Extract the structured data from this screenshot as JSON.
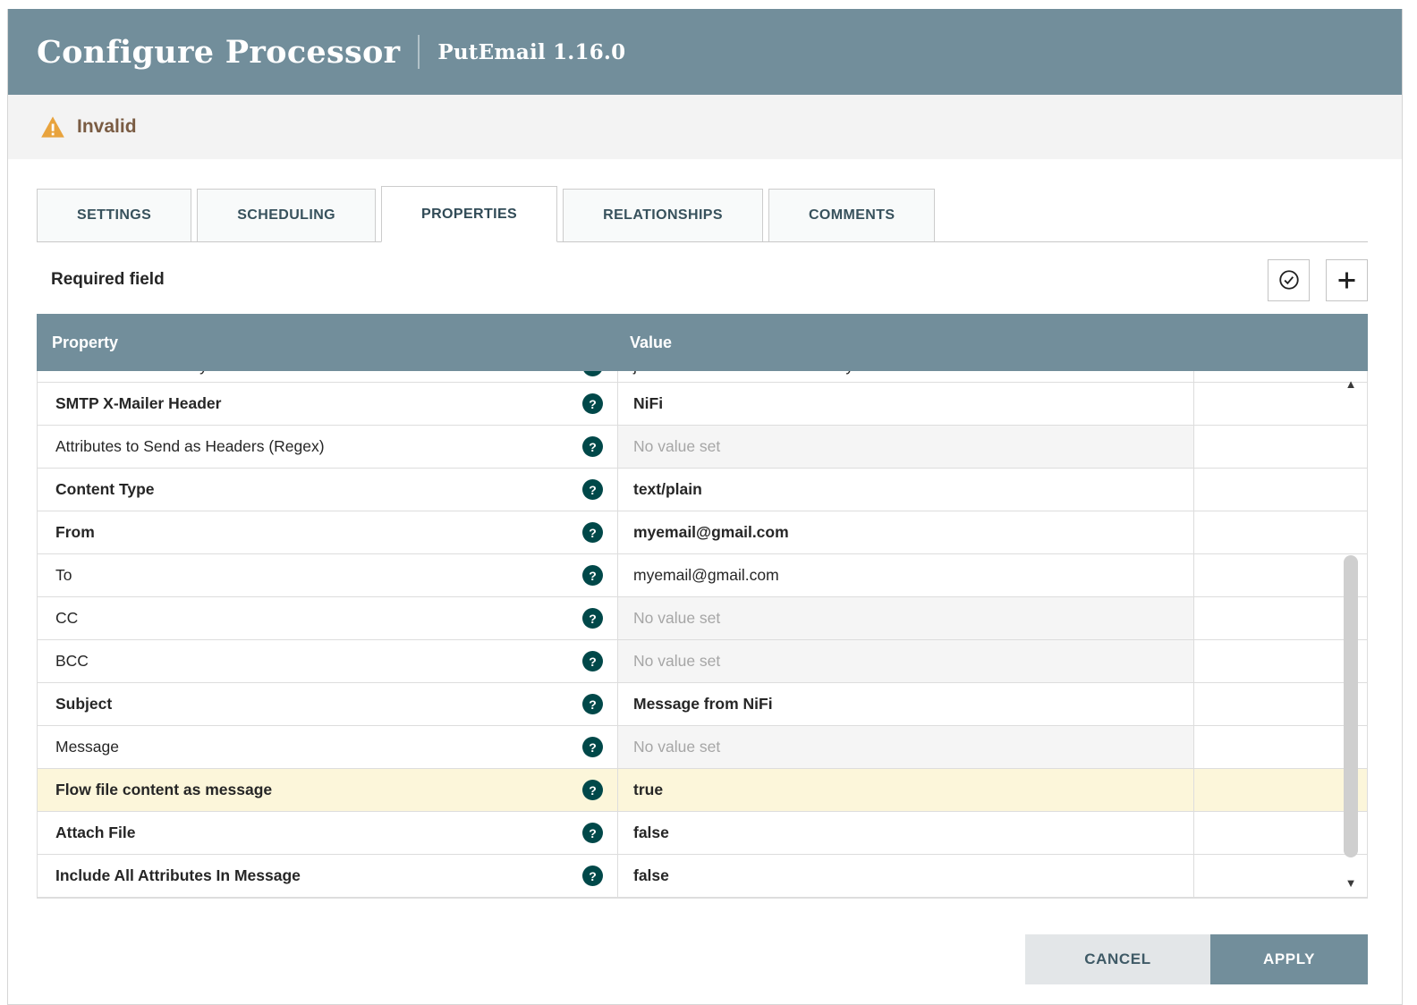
{
  "header": {
    "title": "Configure Processor",
    "subtitle": "PutEmail 1.16.0"
  },
  "banner": {
    "label": "Invalid"
  },
  "tabs": [
    {
      "label": "SETTINGS",
      "active": false
    },
    {
      "label": "SCHEDULING",
      "active": false
    },
    {
      "label": "PROPERTIES",
      "active": true
    },
    {
      "label": "RELATIONSHIPS",
      "active": false
    },
    {
      "label": "COMMENTS",
      "active": false
    }
  ],
  "toolbar": {
    "required_label": "Required field"
  },
  "table": {
    "columns": [
      "Property",
      "Value"
    ],
    "no_value_placeholder": "No value set",
    "rows": [
      {
        "property": "SMTP Socket Factory",
        "value": "javax.net.ssl.SSLSocketFactory",
        "required": false,
        "no_value": false,
        "highlight": false,
        "partial": true
      },
      {
        "property": "SMTP X-Mailer Header",
        "value": "NiFi",
        "required": true,
        "no_value": false,
        "highlight": false,
        "partial": false
      },
      {
        "property": "Attributes to Send as Headers (Regex)",
        "value": "No value set",
        "required": false,
        "no_value": true,
        "highlight": false,
        "partial": false
      },
      {
        "property": "Content Type",
        "value": "text/plain",
        "required": true,
        "no_value": false,
        "highlight": false,
        "partial": false
      },
      {
        "property": "From",
        "value": "myemail@gmail.com",
        "required": true,
        "no_value": false,
        "highlight": false,
        "partial": false
      },
      {
        "property": "To",
        "value": "myemail@gmail.com",
        "required": false,
        "no_value": false,
        "highlight": false,
        "partial": false
      },
      {
        "property": "CC",
        "value": "No value set",
        "required": false,
        "no_value": true,
        "highlight": false,
        "partial": false
      },
      {
        "property": "BCC",
        "value": "No value set",
        "required": false,
        "no_value": true,
        "highlight": false,
        "partial": false
      },
      {
        "property": "Subject",
        "value": "Message from NiFi",
        "required": true,
        "no_value": false,
        "highlight": false,
        "partial": false
      },
      {
        "property": "Message",
        "value": "No value set",
        "required": false,
        "no_value": true,
        "highlight": false,
        "partial": false
      },
      {
        "property": "Flow file content as message",
        "value": "true",
        "required": true,
        "no_value": false,
        "highlight": true,
        "partial": false
      },
      {
        "property": "Attach File",
        "value": "false",
        "required": true,
        "no_value": false,
        "highlight": false,
        "partial": false
      },
      {
        "property": "Include All Attributes In Message",
        "value": "false",
        "required": true,
        "no_value": false,
        "highlight": false,
        "partial": false
      }
    ]
  },
  "icons": {
    "help_glyph": "?",
    "scroll_up": "▲",
    "scroll_down": "▼"
  },
  "footer": {
    "cancel_label": "CANCEL",
    "apply_label": "APPLY"
  },
  "colors": {
    "header_bg": "#728E9B",
    "table_header_bg": "#728E9B",
    "apply_button_bg": "#728E9B",
    "highlight_row_bg": "#FCF6DA",
    "warning_icon": "#E8A33D",
    "invalid_text": "#7A5C43",
    "help_icon_bg": "#004849"
  }
}
